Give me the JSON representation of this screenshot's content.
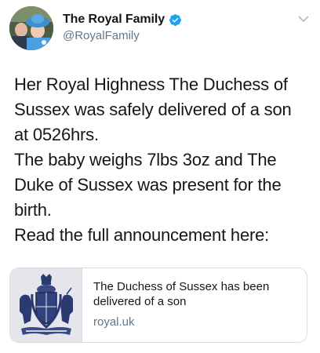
{
  "author": {
    "display_name": "The Royal Family",
    "handle": "@RoyalFamily",
    "verified": true,
    "avatar_icon": "profile-photo"
  },
  "tweet": {
    "paragraphs": [
      "Her Royal Highness The Duchess of Sussex was safely delivered of a son at 0526hrs.",
      "The baby weighs 7lbs 3oz and The Duke of Sussex was present for the birth.",
      "Read the full announcement here:"
    ]
  },
  "link_card": {
    "title": "The Duchess of Sussex has been delivered of a son",
    "domain": "royal.uk",
    "thumbnail_icon": "royal-coat-of-arms-icon"
  },
  "colors": {
    "text": "#14171a",
    "secondary_text": "#657786",
    "verified_blue": "#1da1f2",
    "card_border": "#d9dde1"
  }
}
